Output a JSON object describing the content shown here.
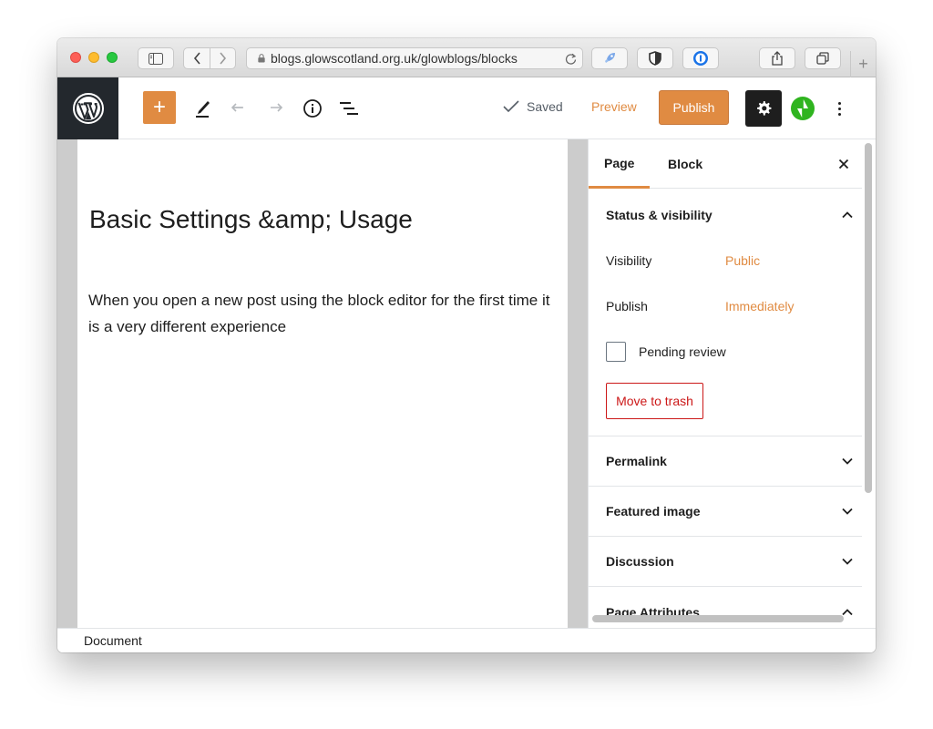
{
  "browser": {
    "url": "blogs.glowscotland.org.uk/glowblogs/blocks"
  },
  "toolbar": {
    "add_block_label": "+",
    "saved_label": "Saved",
    "preview_label": "Preview",
    "publish_label": "Publish",
    "accent_color": "#e08b42"
  },
  "post": {
    "title": "Basic Settings &amp; Usage",
    "paragraph": "When you open a new post using the block editor for the first time it is a very different experience"
  },
  "sidebar": {
    "tabs": [
      {
        "label": "Page",
        "active": true
      },
      {
        "label": "Block",
        "active": false
      }
    ],
    "status_panel": {
      "title": "Status & visibility",
      "visibility_label": "Visibility",
      "visibility_value": "Public",
      "publish_label": "Publish",
      "publish_value": "Immediately",
      "pending_review_label": "Pending review",
      "pending_review_checked": false,
      "trash_label": "Move to trash"
    },
    "panels": [
      {
        "title": "Permalink"
      },
      {
        "title": "Featured image"
      },
      {
        "title": "Discussion"
      },
      {
        "title": "Page Attributes"
      }
    ]
  },
  "footer": {
    "breadcrumb": "Document"
  }
}
